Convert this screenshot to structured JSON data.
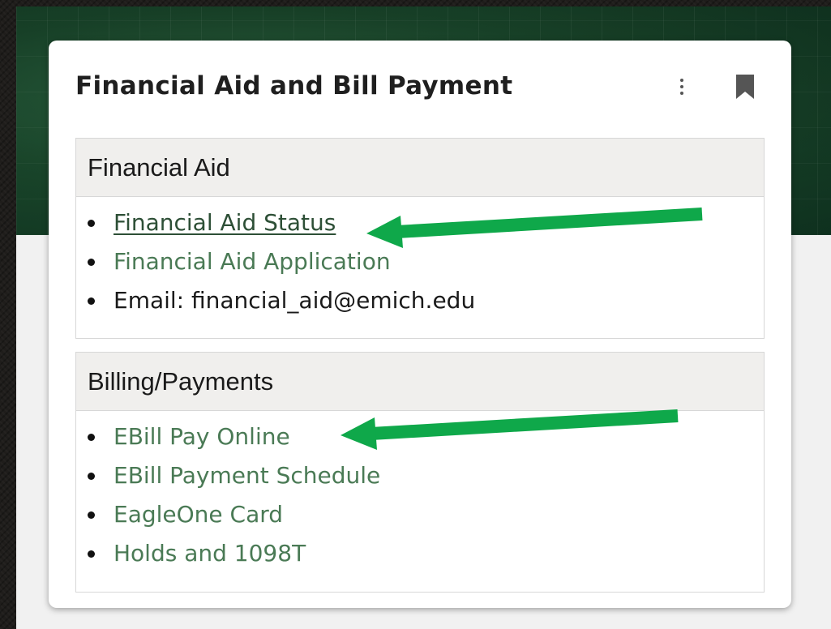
{
  "card": {
    "title": "Financial Aid and Bill Payment"
  },
  "icons": {
    "menu": "more-vertical-icon",
    "bookmark": "bookmark-icon"
  },
  "sections": [
    {
      "heading": "Financial Aid",
      "items": [
        {
          "label": "Financial Aid Status",
          "type": "link",
          "underlined": true
        },
        {
          "label": "Financial Aid Application",
          "type": "link"
        },
        {
          "label": "Email: financial_aid@emich.edu",
          "type": "text"
        }
      ]
    },
    {
      "heading": "Billing/Payments",
      "items": [
        {
          "label": "EBill Pay Online",
          "type": "link"
        },
        {
          "label": "EBill Payment Schedule",
          "type": "link"
        },
        {
          "label": "EagleOne Card",
          "type": "link"
        },
        {
          "label": "Holds and 1098T",
          "type": "link"
        }
      ]
    }
  ],
  "colors": {
    "link": "#4a7a55",
    "link_active": "#2d4f36",
    "annotation_arrow": "#0fa84a",
    "header_band": "#1b4a2d"
  }
}
